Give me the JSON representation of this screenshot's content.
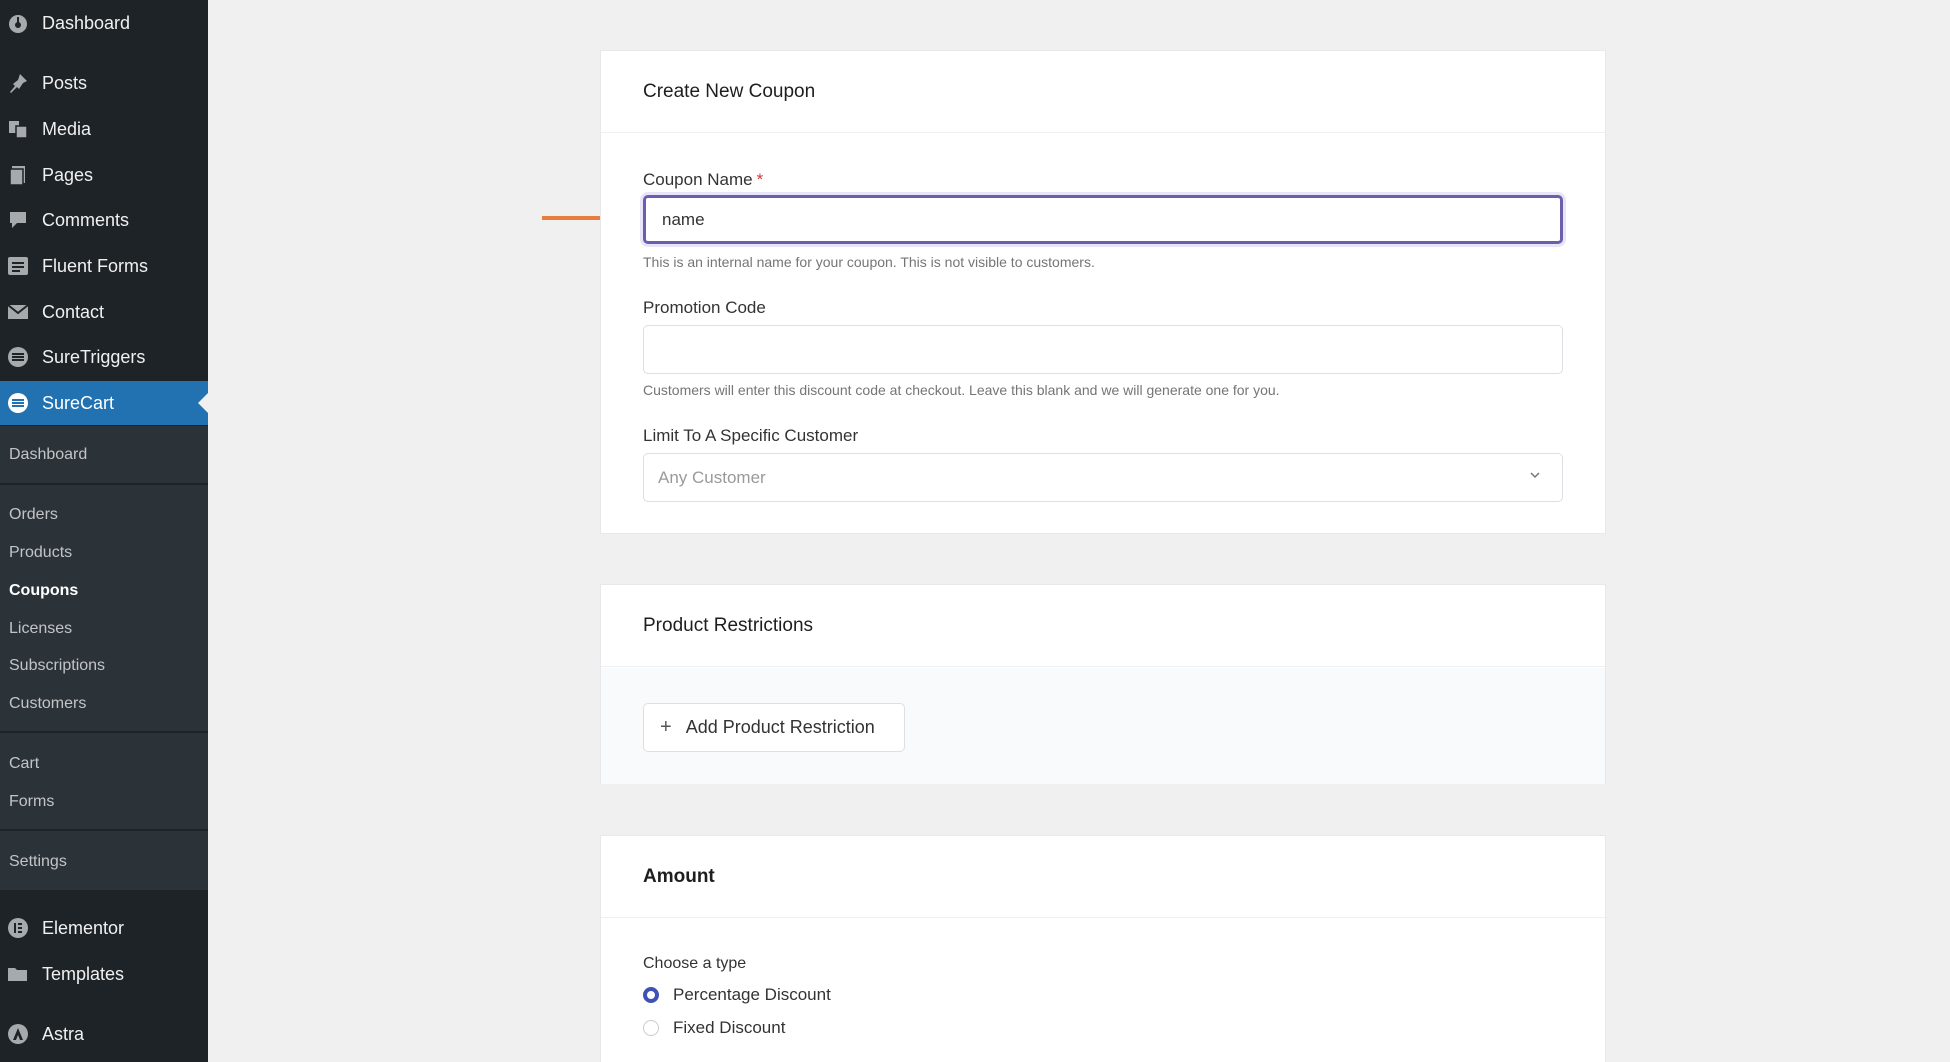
{
  "sidebar": {
    "top_items": [
      {
        "label": "Dashboard",
        "icon": "dashboard-icon"
      },
      {
        "label": "Posts",
        "icon": "pin-icon"
      },
      {
        "label": "Media",
        "icon": "media-icon"
      },
      {
        "label": "Pages",
        "icon": "pages-icon"
      },
      {
        "label": "Comments",
        "icon": "comment-icon"
      },
      {
        "label": "Fluent Forms",
        "icon": "forms-icon"
      },
      {
        "label": "Contact",
        "icon": "mail-icon"
      },
      {
        "label": "SureTriggers",
        "icon": "suretriggers-icon"
      },
      {
        "label": "SureCart",
        "icon": "surecart-icon"
      }
    ],
    "submenu": [
      "Dashboard",
      "Orders",
      "Products",
      "Coupons",
      "Licenses",
      "Subscriptions",
      "Customers",
      "Cart",
      "Forms",
      "Settings"
    ],
    "bottom_items": [
      {
        "label": "Elementor",
        "icon": "elementor-icon"
      },
      {
        "label": "Templates",
        "icon": "folder-icon"
      },
      {
        "label": "Astra",
        "icon": "astra-icon"
      }
    ]
  },
  "coupon_card": {
    "title": "Create New Coupon",
    "name_label": "Coupon Name",
    "required_mark": "*",
    "name_value": "name",
    "name_help": "This is an internal name for your coupon. This is not visible to customers.",
    "promo_label": "Promotion Code",
    "promo_value": "",
    "promo_help": "Customers will enter this discount code at checkout. Leave this blank and we will generate one for you.",
    "customer_label": "Limit To A Specific Customer",
    "customer_placeholder": "Any Customer"
  },
  "product_card": {
    "title": "Product Restrictions",
    "add_button": "Add Product Restriction"
  },
  "amount_card": {
    "title": "Amount",
    "choose_label": "Choose a type",
    "options": [
      "Percentage Discount",
      "Fixed Discount"
    ],
    "selected": "Percentage Discount"
  },
  "colors": {
    "sidebar_bg": "#1d2327",
    "active_blue": "#2271b1",
    "focus_purple": "#6b5eab",
    "arrow_orange": "#e87d3e"
  }
}
